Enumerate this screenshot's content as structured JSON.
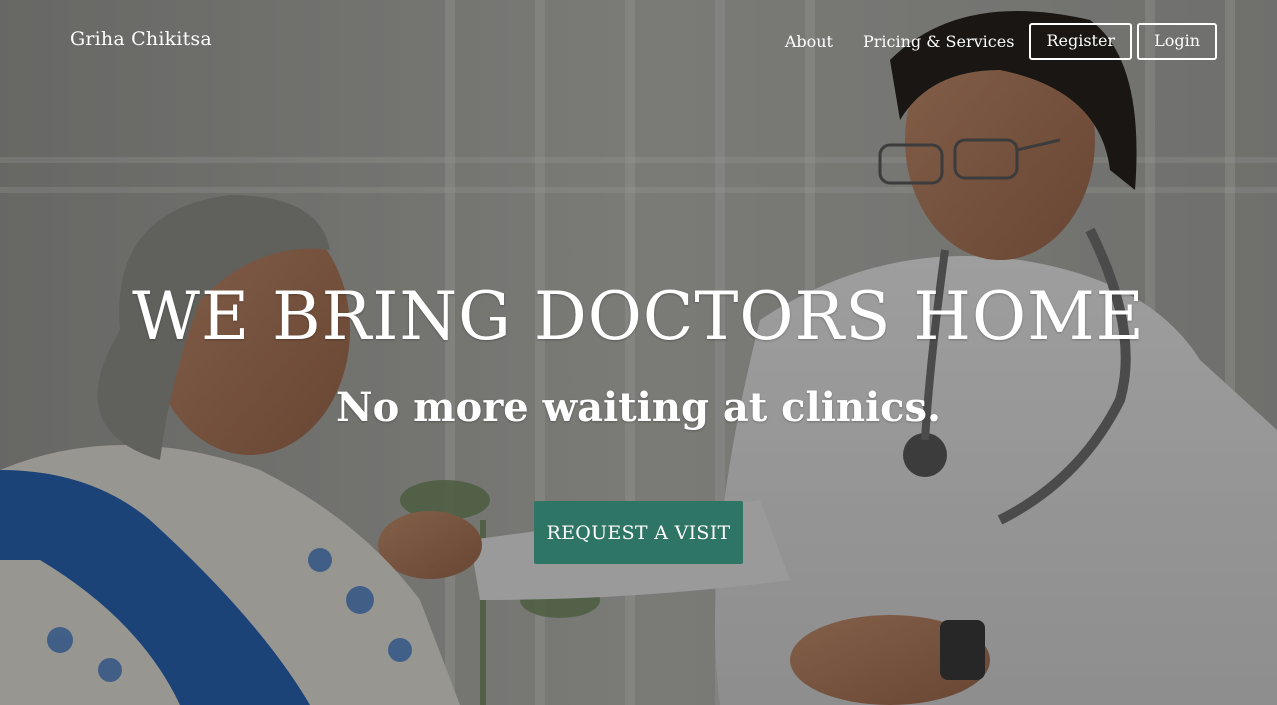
{
  "brand": {
    "name": "Griha Chikitsa"
  },
  "nav": {
    "about": "About",
    "pricing": "Pricing & Services",
    "register": "Register",
    "login": "Login"
  },
  "hero": {
    "headline": "WE BRING DOCTORS HOME",
    "subline": "No more waiting at clinics.",
    "cta": "REQUEST A VISIT",
    "background_image": "doctor-visiting-elderly-patient-photo"
  },
  "colors": {
    "cta_background": "#2f7566",
    "text": "#ffffff",
    "overlay": "rgba(20,20,20,0.38)"
  }
}
